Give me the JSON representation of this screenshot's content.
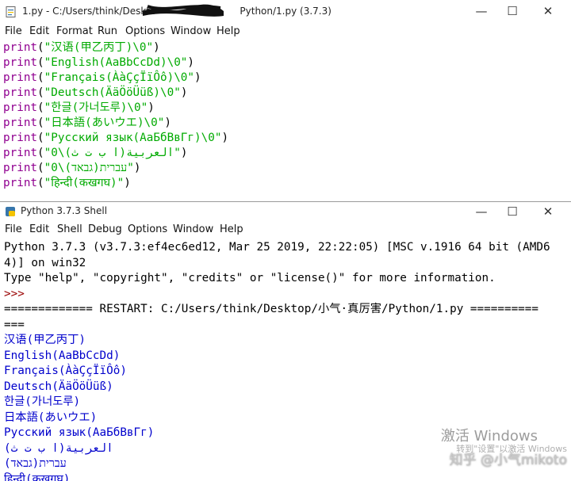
{
  "editor": {
    "title": "1.py - C:/Users/think/Deskte",
    "title_tail": "Python/1.py (3.7.3)",
    "menu": [
      "File",
      "Edit",
      "Format",
      "Run",
      "Options",
      "Window",
      "Help"
    ],
    "lines": [
      {
        "kw": "print",
        "s": "\"汉语(甲乙丙丁)\\0\""
      },
      {
        "kw": "print",
        "s": "\"English(AaBbCcDd)\\0\""
      },
      {
        "kw": "print",
        "s": "\"Français(ÀàÇçÏïÔô)\\0\""
      },
      {
        "kw": "print",
        "s": "\"Deutsch(ÄäÖöÜüß)\\0\""
      },
      {
        "kw": "print",
        "s": "\"한글(가너도루)\\0\""
      },
      {
        "kw": "print",
        "s": "\"日本語(あいウエ)\\0\""
      },
      {
        "kw": "print",
        "s": "\"Русский язык(АаБбВвГг)\\0\""
      },
      {
        "kw": "print",
        "s": "\"العربية(ا ب ت ث)\\0\""
      },
      {
        "kw": "print",
        "s": "\"עברית(גבאד)\\0\""
      },
      {
        "kw": "print",
        "s": "\"हिन्दी(कखगघ)\""
      }
    ]
  },
  "shell": {
    "title": "Python 3.7.3 Shell",
    "menu": [
      "File",
      "Edit",
      "Shell",
      "Debug",
      "Options",
      "Window",
      "Help"
    ],
    "lines": [
      {
        "t": "Python 3.7.3 (v3.7.3:ef4ec6ed12, Mar 25 2019, 22:22:05) [MSC v.1916 64 bit (AMD6",
        "c": "sys"
      },
      {
        "t": "4)] on win32",
        "c": "sys"
      },
      {
        "t": "Type \"help\", \"copyright\", \"credits\" or \"license()\" for more information.",
        "c": "sys"
      },
      {
        "t": ">>> ",
        "c": "prompt"
      },
      {
        "t": "============= RESTART: C:/Users/think/Desktop/小气·真厉害/Python/1.py ==========",
        "c": "sys"
      },
      {
        "t": "===",
        "c": "sys"
      },
      {
        "t": "汉语(甲乙丙丁)",
        "c": "out"
      },
      {
        "t": "English(AaBbCcDd)",
        "c": "out"
      },
      {
        "t": "Français(ÀàÇçÏïÔô)",
        "c": "out"
      },
      {
        "t": "Deutsch(ÄäÖöÜüß)",
        "c": "out"
      },
      {
        "t": "한글(가너도루)",
        "c": "out"
      },
      {
        "t": "日本語(あいウエ)",
        "c": "out"
      },
      {
        "t": "Русский язык(АаБбВвГг)",
        "c": "out"
      },
      {
        "t": "العربية(ا ب ت ث)",
        "c": "out"
      },
      {
        "t": "עברית(גבאד)",
        "c": "out"
      },
      {
        "t": "हिन्दी(कखगघ)",
        "c": "out"
      }
    ]
  },
  "window_controls": {
    "minimize": "—",
    "maximize": "☐",
    "close": "✕"
  },
  "watermark": {
    "activate": "激活 Windows",
    "sub": "转到\"设置\"以激活 Windows",
    "author": "知乎 @小气mikoto"
  },
  "colors": {
    "keyword": "#900090",
    "string": "#00aa00",
    "output": "#0000cc",
    "prompt": "#990000"
  }
}
